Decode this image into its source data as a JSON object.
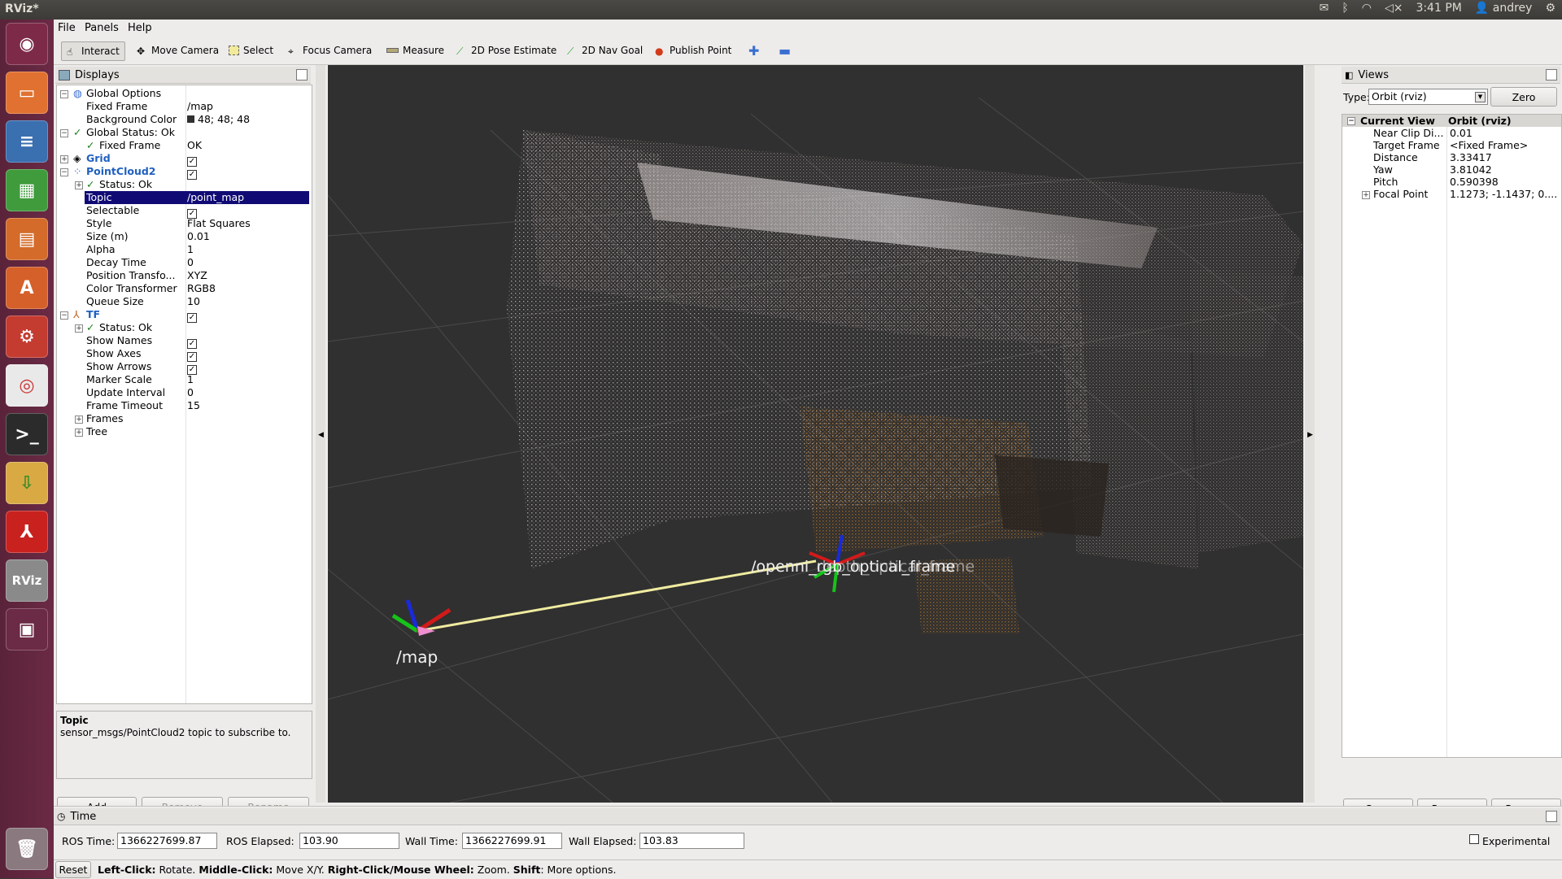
{
  "topbar": {
    "title": "RViz*",
    "time": "3:41 PM",
    "user": "andrey"
  },
  "launcher": {
    "items": [
      "ubuntu-home-icon",
      "files-icon",
      "writer-icon",
      "calc-icon",
      "impress-icon",
      "software-center-icon",
      "settings-icon",
      "chrome-icon",
      "terminal-icon",
      "archive-icon",
      "acrobat-icon",
      "rviz-icon",
      "workspace-icon",
      "trash-icon"
    ],
    "rviz_label": "RViz"
  },
  "menu": {
    "file": "File",
    "panels": "Panels",
    "help": "Help"
  },
  "toolbar": {
    "interact": "Interact",
    "move_camera": "Move Camera",
    "select": "Select",
    "focus_camera": "Focus Camera",
    "measure": "Measure",
    "pose_estimate": "2D Pose Estimate",
    "nav_goal": "2D Nav Goal",
    "publish_point": "Publish Point"
  },
  "displays": {
    "title": "Displays",
    "rows": [
      {
        "k": "Global Options",
        "v": ""
      },
      {
        "k": "Fixed Frame",
        "v": "/map"
      },
      {
        "k": "Background Color",
        "v": "48; 48; 48"
      },
      {
        "k": "Global Status: Ok",
        "v": ""
      },
      {
        "k": "Fixed Frame",
        "v": "OK"
      },
      {
        "k": "Grid",
        "v": ""
      },
      {
        "k": "PointCloud2",
        "v": ""
      },
      {
        "k": "Status: Ok",
        "v": ""
      },
      {
        "k": "Topic",
        "v": "/point_map"
      },
      {
        "k": "Selectable",
        "v": ""
      },
      {
        "k": "Style",
        "v": "Flat Squares"
      },
      {
        "k": "Size (m)",
        "v": "0.01"
      },
      {
        "k": "Alpha",
        "v": "1"
      },
      {
        "k": "Decay Time",
        "v": "0"
      },
      {
        "k": "Position Transfo...",
        "v": "XYZ"
      },
      {
        "k": "Color Transformer",
        "v": "RGB8"
      },
      {
        "k": "Queue Size",
        "v": "10"
      },
      {
        "k": "TF",
        "v": ""
      },
      {
        "k": "Status: Ok",
        "v": ""
      },
      {
        "k": "Show Names",
        "v": ""
      },
      {
        "k": "Show Axes",
        "v": ""
      },
      {
        "k": "Show Arrows",
        "v": ""
      },
      {
        "k": "Marker Scale",
        "v": "1"
      },
      {
        "k": "Update Interval",
        "v": "0"
      },
      {
        "k": "Frame Timeout",
        "v": "15"
      },
      {
        "k": "Frames",
        "v": ""
      },
      {
        "k": "Tree",
        "v": ""
      }
    ],
    "desc_title": "Topic",
    "desc_text": "sensor_msgs/PointCloud2 topic to subscribe to.",
    "add": "Add",
    "remove": "Remove",
    "rename": "Rename"
  },
  "scene": {
    "map_label": "/map",
    "frame_label": "/openni_rgb_optical_frame",
    "frame_label_2": "/openni_depth_optical_frame"
  },
  "views": {
    "title": "Views",
    "type_label": "Type:",
    "type_value": "Orbit (rviz)",
    "zero": "Zero",
    "header_k": "Current View",
    "header_v": "Orbit (rviz)",
    "rows": [
      {
        "k": "Near Clip Di...",
        "v": "0.01"
      },
      {
        "k": "Target Frame",
        "v": "<Fixed Frame>"
      },
      {
        "k": "Distance",
        "v": "3.33417"
      },
      {
        "k": "Yaw",
        "v": "3.81042"
      },
      {
        "k": "Pitch",
        "v": "0.590398"
      },
      {
        "k": "Focal Point",
        "v": "1.1273; -1.1437; 0...."
      }
    ],
    "save": "Save",
    "remove": "Remove",
    "rename": "Rename"
  },
  "time": {
    "title": "Time",
    "ros_time_label": "ROS Time:",
    "ros_time": "1366227699.87",
    "ros_elapsed_label": "ROS Elapsed:",
    "ros_elapsed": "103.90",
    "wall_time_label": "Wall Time:",
    "wall_time": "1366227699.91",
    "wall_elapsed_label": "Wall Elapsed:",
    "wall_elapsed": "103.83",
    "experimental": "Experimental"
  },
  "statusbar": {
    "reset": "Reset",
    "hint_b1": "Left-Click:",
    "hint_t1": " Rotate. ",
    "hint_b2": "Middle-Click:",
    "hint_t2": " Move X/Y. ",
    "hint_b3": "Right-Click/Mouse Wheel:",
    "hint_t3": " Zoom. ",
    "hint_b4": "Shift",
    "hint_t4": ": More options."
  }
}
